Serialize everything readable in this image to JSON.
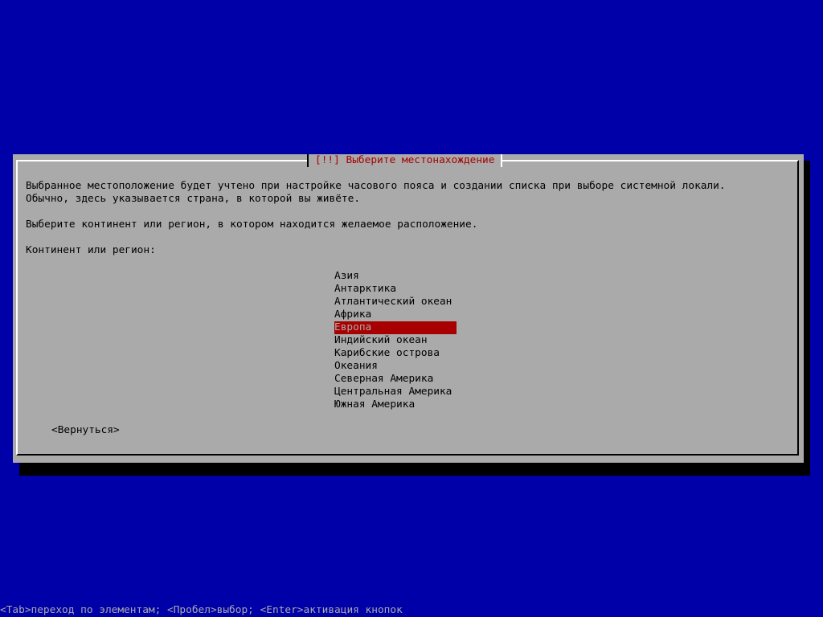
{
  "dialog": {
    "title": "[!!] Выберите местонахождение",
    "description_line1": "Выбранное местоположение будет учтено при настройке часового пояса и создании списка при выборе системной локали.",
    "description_line2": "Обычно, здесь указывается страна, в которой вы живёте.",
    "prompt": "Выберите континент или регион, в котором находится желаемое расположение.",
    "list_label": "Континент или регион:",
    "regions": [
      {
        "label": "Азия",
        "selected": false
      },
      {
        "label": "Антарктика",
        "selected": false
      },
      {
        "label": "Атлантический океан",
        "selected": false
      },
      {
        "label": "Африка",
        "selected": false
      },
      {
        "label": "Европа",
        "selected": true
      },
      {
        "label": "Индийский океан",
        "selected": false
      },
      {
        "label": "Карибские острова",
        "selected": false
      },
      {
        "label": "Океания",
        "selected": false
      },
      {
        "label": "Северная Америка",
        "selected": false
      },
      {
        "label": "Центральная Америка",
        "selected": false
      },
      {
        "label": "Южная Америка",
        "selected": false
      }
    ],
    "back_button": "<Вернуться>"
  },
  "status_bar": {
    "text": "<Tab>переход по элементам; <Пробел>выбор; <Enter>активация кнопок"
  },
  "colors": {
    "background": "#0000a8",
    "dialog": "#aaaaaa",
    "title_text": "#a80000",
    "selection": "#a80000"
  }
}
